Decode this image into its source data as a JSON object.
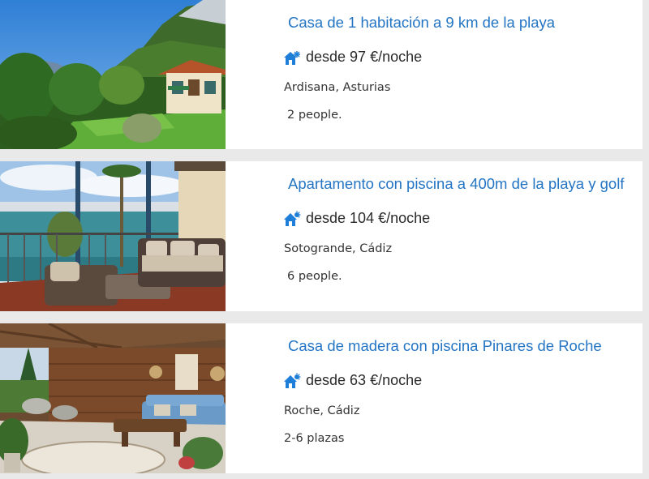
{
  "listings": [
    {
      "title": "Casa de 1 habitación a 9 km de la playa",
      "price": "desde 97 €/noche",
      "location": "Ardisana, Asturias",
      "capacity": "2 people.",
      "icon": "snowflake-house-icon",
      "photo": "mountain-house-photo"
    },
    {
      "title": "Apartamento con piscina a 400m de la playa y golf",
      "price": "desde 104 €/noche",
      "location": "Sotogrande, Cádiz",
      "capacity": "6 people.",
      "icon": "sun-house-icon",
      "photo": "marina-terrace-photo"
    },
    {
      "title": "Casa de madera con piscina Pinares de Roche",
      "price": "desde 63 €/noche",
      "location": "Roche, Cádiz",
      "capacity": "2-6 plazas",
      "icon": "sun-house-icon",
      "photo": "wooden-porch-photo"
    }
  ],
  "colors": {
    "title": "#2375c4",
    "icon": "#1f7fd8",
    "background": "#e9e9ea"
  }
}
